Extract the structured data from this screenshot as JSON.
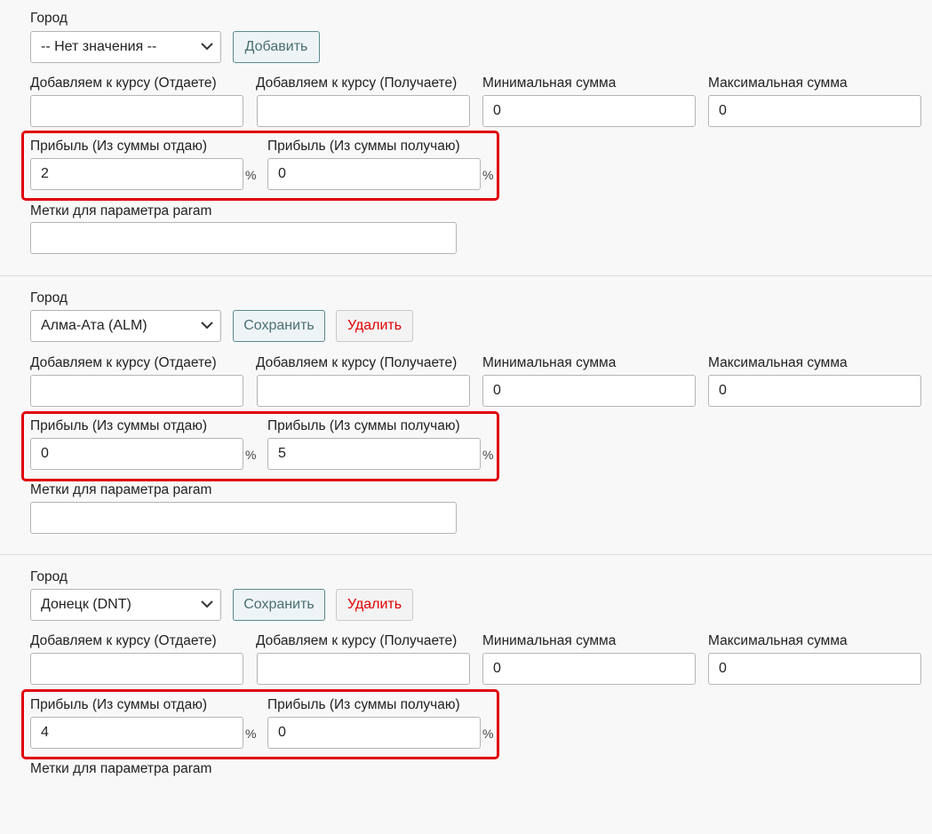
{
  "labels": {
    "city": "Город",
    "add_rate_give": "Добавляем к курсу (Отдаете)",
    "add_rate_get": "Добавляем к курсу (Получаете)",
    "min_sum": "Минимальная сумма",
    "max_sum": "Максимальная сумма",
    "profit_give": "Прибыль (Из суммы отдаю)",
    "profit_get": "Прибыль (Из суммы получаю)",
    "param_tags": "Метки для параметра param",
    "percent": "%"
  },
  "buttons": {
    "add": "Добавить",
    "save": "Сохранить",
    "delete": "Удалить"
  },
  "entries": [
    {
      "city": "-- Нет значения --",
      "add_give": "",
      "add_get": "",
      "min": "0",
      "max": "0",
      "profit_give": "2",
      "profit_get": "0",
      "tags": ""
    },
    {
      "city": "Алма-Ата (ALM)",
      "add_give": "",
      "add_get": "",
      "min": "0",
      "max": "0",
      "profit_give": "0",
      "profit_get": "5",
      "tags": ""
    },
    {
      "city": "Донецк (DNT)",
      "add_give": "",
      "add_get": "",
      "min": "0",
      "max": "0",
      "profit_give": "4",
      "profit_get": "0",
      "tags": ""
    }
  ],
  "colors": {
    "highlight": "#e0000a",
    "delete_text": "#e00000",
    "button_text": "#4a6f74"
  }
}
